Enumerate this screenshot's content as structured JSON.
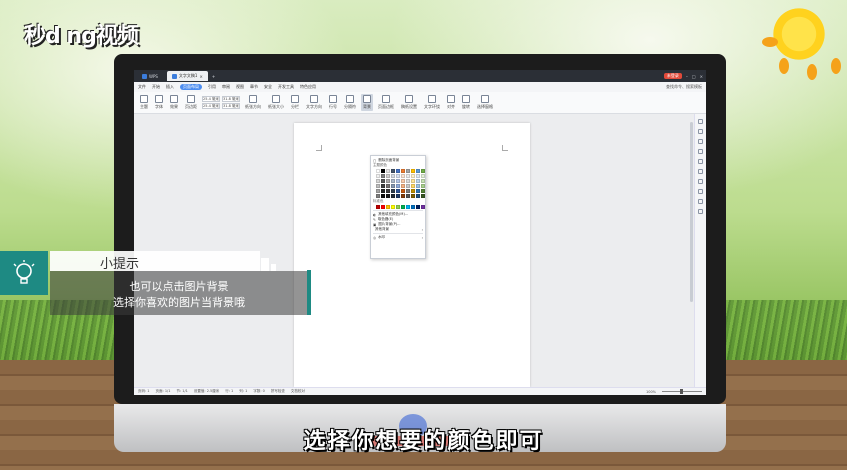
{
  "video": {
    "logo_text": "秒d ng视频",
    "tip_title": "小提示",
    "tip_lines": [
      "也可以点击图片背景",
      "选择你喜欢的图片当背景哦"
    ],
    "caption": "选择你想要的颜色即可"
  },
  "app": {
    "tabs": [
      {
        "label": "WPS",
        "active": false
      },
      {
        "label": "文字文稿1",
        "active": true
      }
    ],
    "user_badge": "未登录",
    "menu": [
      "文件",
      "开始",
      "插入",
      "页面布局",
      "引用",
      "审阅",
      "视图",
      "章节",
      "安全",
      "开发工具",
      "特色应用"
    ],
    "menu_active": "页面布局",
    "menu_right": "查找命令、搜索模板",
    "ribbon": {
      "buttons": [
        "主题",
        "字体",
        "效果",
        "页边距",
        "纸张方向",
        "纸张大小",
        "分栏",
        "文字方向",
        "行号",
        "分隔符",
        "背景",
        "页面边框",
        "稿纸设置",
        "文字环绕",
        "对齐",
        "旋转",
        "选择窗格"
      ],
      "selected": "背景",
      "margin_fields": {
        "top": "25.4 毫米",
        "bottom": "25.4 毫米",
        "left": "31.8 毫米",
        "right": "31.8 毫米"
      }
    },
    "dropdown": {
      "top_item": "删除页面背景",
      "theme_label": "主题颜色",
      "standard_label": "标准色",
      "items": [
        "其他填充颜色(M)...",
        "取色器(E)",
        "图片背景(P)...",
        "其他背景",
        "水印"
      ],
      "theme_colors": [
        [
          "#ffffff",
          "#000000",
          "#e7e6e6",
          "#44546a",
          "#4472c4",
          "#ed7d31",
          "#a5a5a5",
          "#ffc000",
          "#5b9bd5",
          "#70ad47"
        ],
        [
          "#f2f2f2",
          "#7f7f7f",
          "#d0cece",
          "#d6dce4",
          "#d9e2f3",
          "#fbe5d5",
          "#ededed",
          "#fff2cc",
          "#deebf6",
          "#e2efd9"
        ],
        [
          "#d8d8d8",
          "#595959",
          "#aeabab",
          "#adb9ca",
          "#b4c6e7",
          "#f7cbac",
          "#dbdbdb",
          "#fee599",
          "#bdd7ee",
          "#c5e0b3"
        ],
        [
          "#bfbfbf",
          "#3f3f3f",
          "#757070",
          "#8496b0",
          "#8eaadb",
          "#f4b183",
          "#c9c9c9",
          "#ffd965",
          "#9cc3e5",
          "#a8d08d"
        ],
        [
          "#a5a5a5",
          "#262626",
          "#3a3838",
          "#323f4f",
          "#2f5496",
          "#c55a11",
          "#7b7b7b",
          "#bf9000",
          "#2e75b5",
          "#538135"
        ],
        [
          "#7f7f7f",
          "#0c0c0c",
          "#171616",
          "#222a35",
          "#1f3864",
          "#833c0b",
          "#525252",
          "#7f6000",
          "#1e4e79",
          "#375623"
        ]
      ],
      "standard_colors": [
        "#c00000",
        "#ff0000",
        "#ffc000",
        "#ffff00",
        "#92d050",
        "#00b050",
        "#00b0f0",
        "#0070c0",
        "#002060",
        "#7030a0"
      ]
    },
    "status": {
      "left": [
        "页码: 1",
        "页面: 1/1",
        "节: 1/1",
        "设置值: 2.5厘米",
        "行: 1",
        "列: 1",
        "字数: 0",
        "拼写检查",
        "文档校对"
      ],
      "zoom": "100%"
    }
  }
}
